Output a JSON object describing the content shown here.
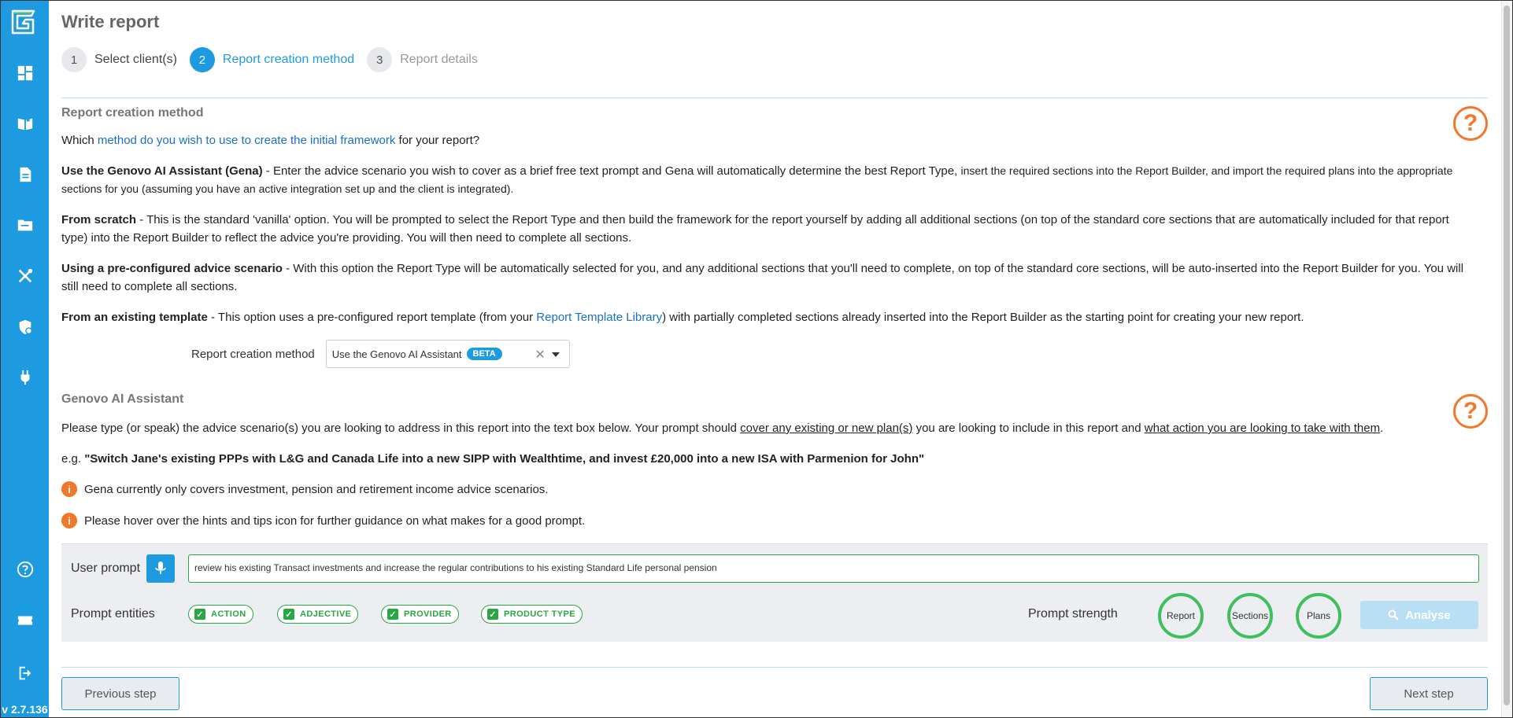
{
  "app": {
    "version": "v 2.7.136"
  },
  "sidebar": {
    "items": [
      {
        "icon": "dashboard-icon"
      },
      {
        "icon": "book-icon"
      },
      {
        "icon": "document-icon"
      },
      {
        "icon": "folder-icon"
      },
      {
        "icon": "tools-icon"
      },
      {
        "icon": "shield-icon"
      },
      {
        "icon": "plug-icon"
      },
      {
        "icon": "help-icon"
      },
      {
        "icon": "ticket-icon"
      },
      {
        "icon": "logout-icon"
      }
    ]
  },
  "page": {
    "title": "Write report"
  },
  "stepper": {
    "steps": [
      {
        "num": "1",
        "label": "Select client(s)",
        "state": "done"
      },
      {
        "num": "2",
        "label": "Report creation method",
        "state": "active"
      },
      {
        "num": "3",
        "label": "Report details",
        "state": "future"
      }
    ]
  },
  "creation": {
    "title": "Report creation method",
    "question_pre": "Which ",
    "question_link": "method do you wish to use to create the initial framework",
    "question_post": " for your report?",
    "gena_bold": "Use the Genovo AI Assistant (Gena)",
    "gena_text": " - Enter the advice scenario you wish to cover as a brief free text prompt and Gena will automatically determine the best Report Type, ",
    "gena_small": "insert the required sections into the Report Builder, and import the required plans into the appropriate sections for you (assuming you have an active integration set up and the client is integrated).",
    "scratch_bold": "From scratch",
    "scratch_text": " - This is the standard 'vanilla' option. You will be prompted to select the Report Type and then build the framework for the report yourself by adding all additional sections (on top of the standard core sections that are automatically included for that report type) into the Report Builder to reflect the advice you're providing. You will then need to complete all sections.",
    "preconf_bold": "Using a pre-configured advice scenario",
    "preconf_text": " - With this option the Report Type will be automatically selected for you, and any additional sections that you'll need to complete, on top of the standard core sections, will be auto-inserted into the Report Builder for you. You will still need to complete all sections.",
    "template_bold": "From an existing template",
    "template_text_pre": " - This option uses a pre-configured report template (from your ",
    "template_link": "Report Template Library",
    "template_text_post": ") with partially completed sections already inserted into the Report Builder as the starting point for creating your new report.",
    "method_label": "Report creation method",
    "method_value": "Use the Genovo AI Assistant",
    "method_badge": "BETA"
  },
  "gena": {
    "title": "Genovo AI Assistant",
    "intro_pre": "Please type (or speak) the advice scenario(s) you are looking to address in this report into the text box below. Your prompt should ",
    "intro_link1": "cover any existing or new plan(s)",
    "intro_mid": " you are looking to include in this report and ",
    "intro_link2": "what action you are looking to take with them",
    "intro_post": ".",
    "example_prefix": "e.g. ",
    "example_text": "\"Switch Jane's existing PPPs with L&G and Canada Life into a new SIPP with Wealthtime, and invest £20,000 into a new ISA with Parmenion for John\"",
    "info1": "Gena currently only covers investment, pension and retirement income advice scenarios.",
    "info2": "Please hover over the hints and tips icon for further guidance on what makes for a good prompt.",
    "info_glyph": "i"
  },
  "prompt": {
    "label": "User prompt",
    "value": "review his existing Transact investments and increase the regular contributions to his existing Standard Life personal pension",
    "entities_label": "Prompt entities",
    "entities": [
      "ACTION",
      "ADJECTIVE",
      "PROVIDER",
      "PRODUCT TYPE"
    ],
    "strength_label": "Prompt strength",
    "strength": [
      "Report",
      "Sections",
      "Plans"
    ],
    "analyse_label": "Analyse"
  },
  "nav": {
    "previous": "Previous step",
    "next": "Next step"
  },
  "colors": {
    "brand": "#1e9be0",
    "accent_orange": "#f07828",
    "success_green": "#28a745"
  }
}
